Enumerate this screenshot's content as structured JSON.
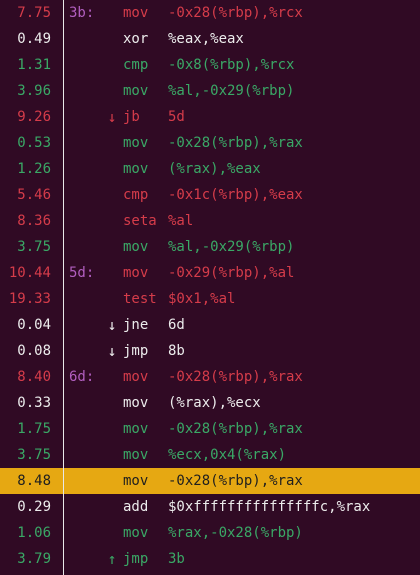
{
  "colors": {
    "background": "#300a24",
    "red": "#d53c4a",
    "green": "#3aa866",
    "white": "#ececec",
    "label": "#b25fc0",
    "highlight": "#e6a812"
  },
  "rows": [
    {
      "pct": "7.75",
      "label": "3b:",
      "arrow": "",
      "arrow_icon": "",
      "mnemonic": "mov",
      "operands": "-0x28(%rbp),%rcx",
      "color": "red",
      "highlight": false
    },
    {
      "pct": "0.49",
      "label": "",
      "arrow": "",
      "arrow_icon": "",
      "mnemonic": "xor",
      "operands": "%eax,%eax",
      "color": "white",
      "highlight": false
    },
    {
      "pct": "1.31",
      "label": "",
      "arrow": "",
      "arrow_icon": "",
      "mnemonic": "cmp",
      "operands": "-0x8(%rbp),%rcx",
      "color": "green",
      "highlight": false
    },
    {
      "pct": "3.96",
      "label": "",
      "arrow": "",
      "arrow_icon": "",
      "mnemonic": "mov",
      "operands": "%al,-0x29(%rbp)",
      "color": "green",
      "highlight": false
    },
    {
      "pct": "9.26",
      "label": "",
      "arrow": "↓",
      "arrow_icon": "down-arrow-icon",
      "mnemonic": "jb",
      "operands": "5d",
      "color": "red",
      "highlight": false
    },
    {
      "pct": "0.53",
      "label": "",
      "arrow": "",
      "arrow_icon": "",
      "mnemonic": "mov",
      "operands": "-0x28(%rbp),%rax",
      "color": "green",
      "highlight": false
    },
    {
      "pct": "1.26",
      "label": "",
      "arrow": "",
      "arrow_icon": "",
      "mnemonic": "mov",
      "operands": "(%rax),%eax",
      "color": "green",
      "highlight": false
    },
    {
      "pct": "5.46",
      "label": "",
      "arrow": "",
      "arrow_icon": "",
      "mnemonic": "cmp",
      "operands": "-0x1c(%rbp),%eax",
      "color": "red",
      "highlight": false
    },
    {
      "pct": "8.36",
      "label": "",
      "arrow": "",
      "arrow_icon": "",
      "mnemonic": "seta",
      "operands": "%al",
      "color": "red",
      "highlight": false
    },
    {
      "pct": "3.75",
      "label": "",
      "arrow": "",
      "arrow_icon": "",
      "mnemonic": "mov",
      "operands": "%al,-0x29(%rbp)",
      "color": "green",
      "highlight": false
    },
    {
      "pct": "10.44",
      "label": "5d:",
      "arrow": "",
      "arrow_icon": "",
      "mnemonic": "mov",
      "operands": "-0x29(%rbp),%al",
      "color": "red",
      "highlight": false
    },
    {
      "pct": "19.33",
      "label": "",
      "arrow": "",
      "arrow_icon": "",
      "mnemonic": "test",
      "operands": "$0x1,%al",
      "color": "red",
      "highlight": false
    },
    {
      "pct": "0.04",
      "label": "",
      "arrow": "↓",
      "arrow_icon": "down-arrow-icon",
      "mnemonic": "jne",
      "operands": "6d",
      "color": "white",
      "highlight": false
    },
    {
      "pct": "0.08",
      "label": "",
      "arrow": "↓",
      "arrow_icon": "down-arrow-icon",
      "mnemonic": "jmp",
      "operands": "8b",
      "color": "white",
      "highlight": false
    },
    {
      "pct": "8.40",
      "label": "6d:",
      "arrow": "",
      "arrow_icon": "",
      "mnemonic": "mov",
      "operands": "-0x28(%rbp),%rax",
      "color": "red",
      "highlight": false
    },
    {
      "pct": "0.33",
      "label": "",
      "arrow": "",
      "arrow_icon": "",
      "mnemonic": "mov",
      "operands": "(%rax),%ecx",
      "color": "white",
      "highlight": false
    },
    {
      "pct": "1.75",
      "label": "",
      "arrow": "",
      "arrow_icon": "",
      "mnemonic": "mov",
      "operands": "-0x28(%rbp),%rax",
      "color": "green",
      "highlight": false
    },
    {
      "pct": "3.75",
      "label": "",
      "arrow": "",
      "arrow_icon": "",
      "mnemonic": "mov",
      "operands": "%ecx,0x4(%rax)",
      "color": "green",
      "highlight": false
    },
    {
      "pct": "8.48",
      "label": "",
      "arrow": "",
      "arrow_icon": "",
      "mnemonic": "mov",
      "operands": "-0x28(%rbp),%rax",
      "color": "red",
      "highlight": true
    },
    {
      "pct": "0.29",
      "label": "",
      "arrow": "",
      "arrow_icon": "",
      "mnemonic": "add",
      "operands": "$0xfffffffffffffffc,%rax",
      "color": "white",
      "highlight": false
    },
    {
      "pct": "1.06",
      "label": "",
      "arrow": "",
      "arrow_icon": "",
      "mnemonic": "mov",
      "operands": "%rax,-0x28(%rbp)",
      "color": "green",
      "highlight": false
    },
    {
      "pct": "3.79",
      "label": "",
      "arrow": "↑",
      "arrow_icon": "up-arrow-icon",
      "mnemonic": "jmp",
      "operands": "3b",
      "color": "green",
      "highlight": false
    }
  ]
}
